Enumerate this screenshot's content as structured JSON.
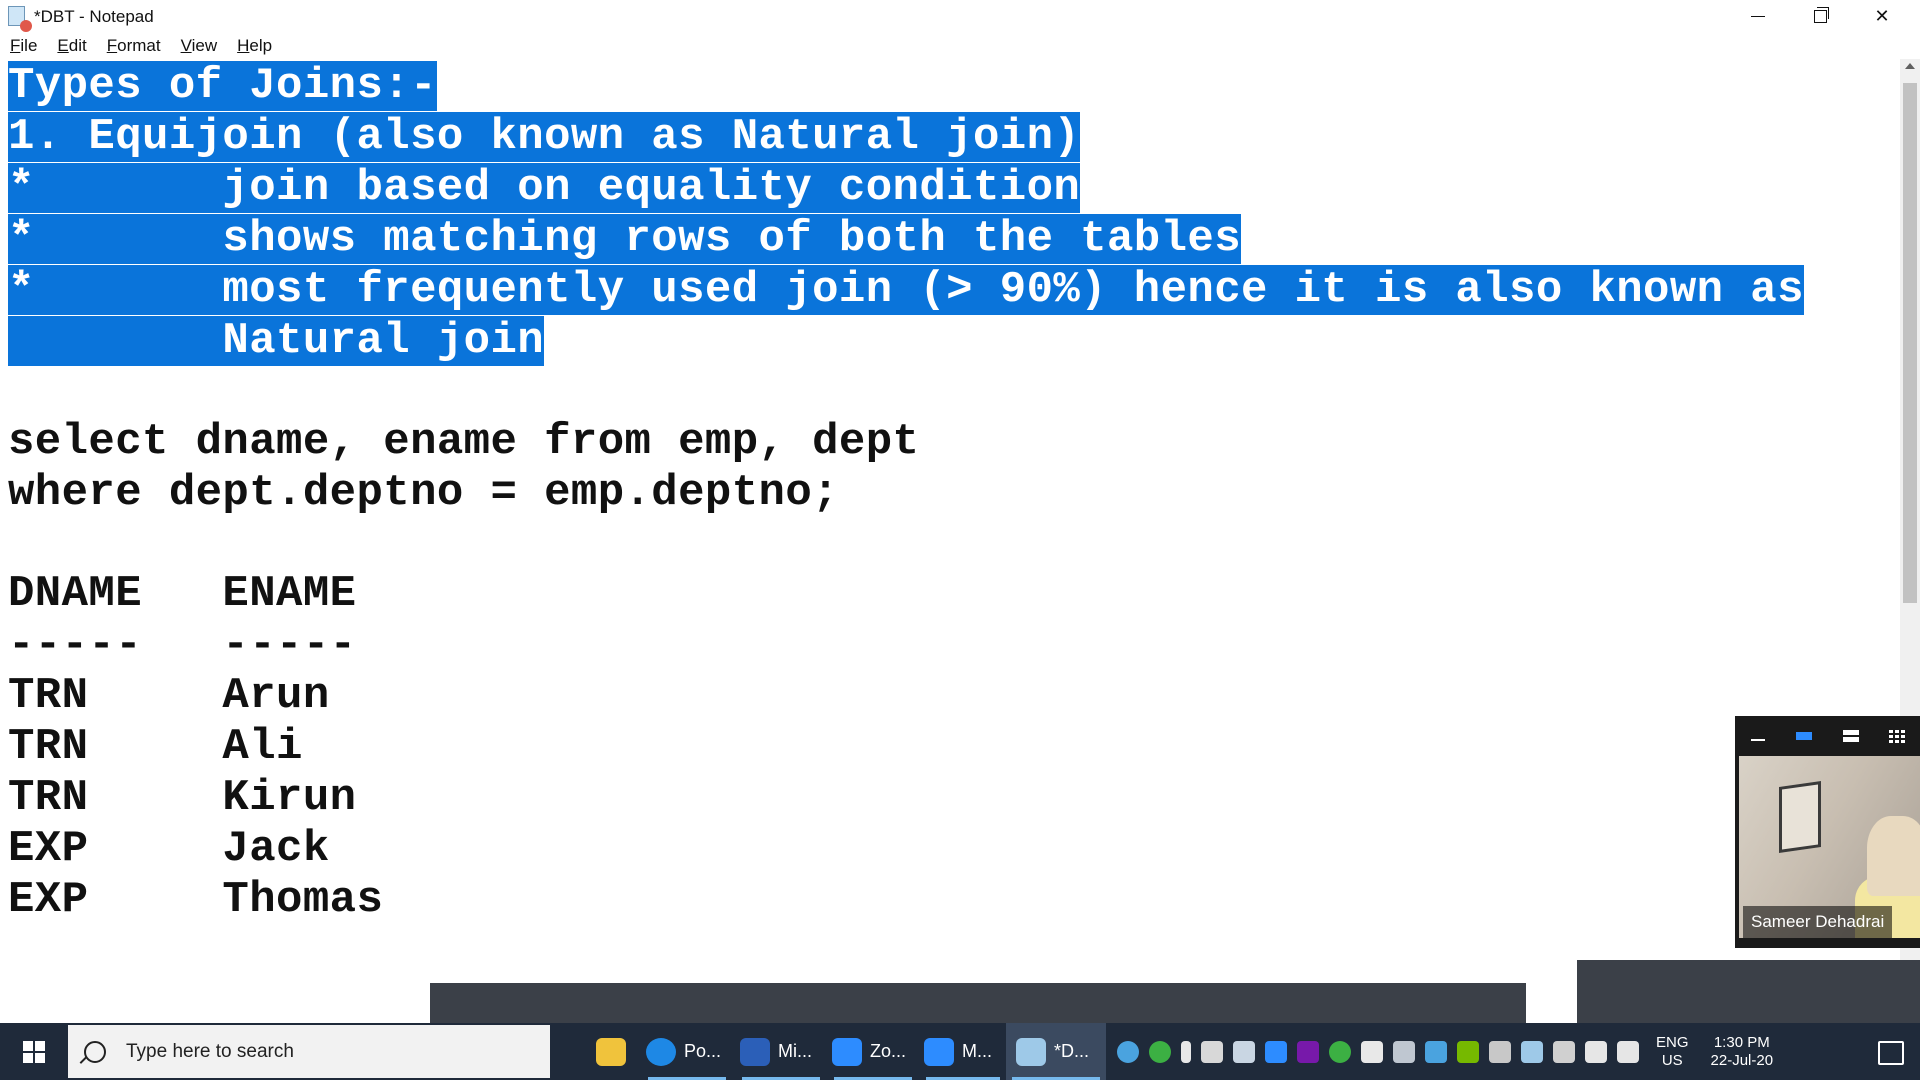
{
  "window": {
    "title": "*DBT - Notepad"
  },
  "menu": {
    "items": [
      {
        "key": "F",
        "rest": "ile"
      },
      {
        "key": "E",
        "rest": "dit"
      },
      {
        "key": "F",
        "rest": "ormat"
      },
      {
        "key": "V",
        "rest": "iew"
      },
      {
        "key": "H",
        "rest": "elp"
      }
    ]
  },
  "editor": {
    "selected_lines": [
      "Types of Joins:-",
      "1. Equijoin (also known as Natural join)",
      "*       join based on equality condition",
      "*       shows matching rows of both the tables",
      "*       most frequently used join (> 90%) hence it is also known as",
      "        Natural join"
    ],
    "query_lines": [
      "select dname, ename from emp, dept",
      "where dept.deptno = emp.deptno;"
    ],
    "result_header": "DNAME   ENAME",
    "result_separator": "-----   -----",
    "result_rows": [
      "TRN     Arun",
      "TRN     Ali",
      "TRN     Kirun",
      "EXP     Jack",
      "EXP     Thomas"
    ]
  },
  "zoom": {
    "participant_name": "Sameer Dehadrai"
  },
  "taskbar": {
    "search_placeholder": "Type here to search",
    "apps": [
      {
        "label": "Po...",
        "color": "#1e88e5"
      },
      {
        "label": "Mi...",
        "color": "#2b5fb8"
      },
      {
        "label": "Zo...",
        "color": "#2d8cff"
      },
      {
        "label": "M...",
        "color": "#2d8cff"
      },
      {
        "label": "*D...",
        "color": "#9ec9e8"
      }
    ],
    "lang_line1": "ENG",
    "lang_line2": "US",
    "time": "1:30 PM",
    "date": "22-Jul-20"
  }
}
